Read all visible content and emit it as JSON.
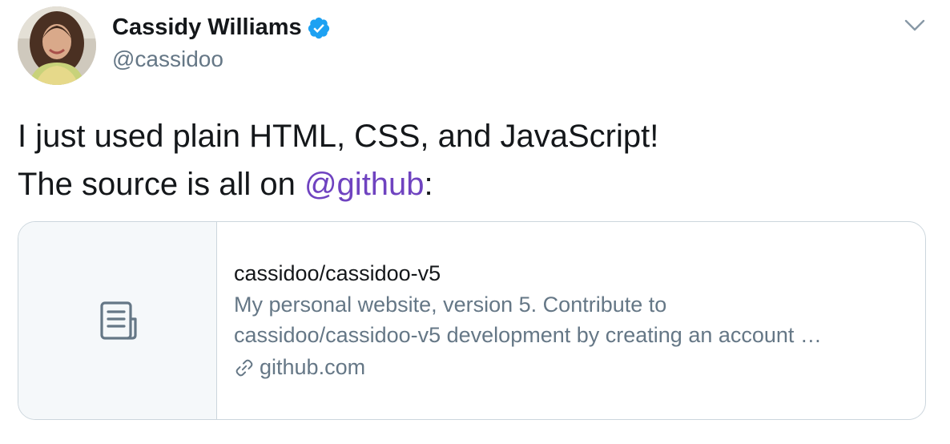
{
  "author": {
    "display_name": "Cassidy Williams",
    "handle": "@cassidoo",
    "verified_icon": "verified-badge-icon",
    "avatar": "avatar-photo"
  },
  "tweet": {
    "line1": "I just used plain HTML, CSS, and JavaScript!",
    "line2_prefix": "The source is all on ",
    "mention": "@github",
    "line2_suffix": ":"
  },
  "card": {
    "thumb_icon": "document-icon",
    "title": "cassidoo/cassidoo-v5",
    "description_line1": "My personal website, version 5. Contribute to",
    "description_line2": "cassidoo/cassidoo-v5 development by creating an account …",
    "domain_icon": "link-icon",
    "domain": "github.com"
  },
  "colors": {
    "text": "#14171a",
    "secondary": "#657786",
    "mention": "#6f43c0",
    "verified": "#1da1f2",
    "border": "#ccd6dd",
    "thumb_bg": "#f5f8fa"
  },
  "menu_icon": "chevron-down-icon"
}
